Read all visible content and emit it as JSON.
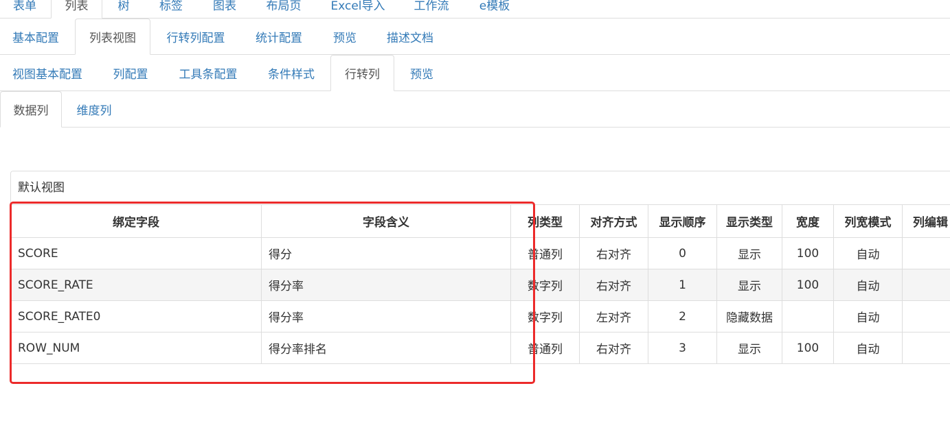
{
  "tabs_level1": [
    "表单",
    "列表",
    "树",
    "标签",
    "图表",
    "布局页",
    "Excel导入",
    "工作流",
    "e模板"
  ],
  "tabs_level2": [
    "基本配置",
    "列表视图",
    "行转列配置",
    "统计配置",
    "预览",
    "描述文档"
  ],
  "tabs_level3": [
    "视图基本配置",
    "列配置",
    "工具条配置",
    "条件样式",
    "行转列",
    "预览"
  ],
  "tabs_level4": [
    "数据列",
    "维度列"
  ],
  "panel": {
    "title": "默认视图"
  },
  "table": {
    "headers": [
      "绑定字段",
      "字段含义",
      "列类型",
      "对齐方式",
      "显示顺序",
      "显示类型",
      "宽度",
      "列宽模式",
      "列编辑"
    ],
    "rows": [
      [
        "SCORE",
        "得分",
        "普通列",
        "右对齐",
        "0",
        "显示",
        "100",
        "自动",
        ""
      ],
      [
        "SCORE_RATE",
        "得分率",
        "数字列",
        "右对齐",
        "1",
        "显示",
        "100",
        "自动",
        ""
      ],
      [
        "SCORE_RATE0",
        "得分率",
        "数字列",
        "左对齐",
        "2",
        "隐藏数据",
        "",
        "自动",
        ""
      ],
      [
        "ROW_NUM",
        "得分率排名",
        "普通列",
        "右对齐",
        "3",
        "显示",
        "100",
        "自动",
        ""
      ]
    ]
  },
  "colors": {
    "link": "#337ab7",
    "active_text": "#555555",
    "border": "#dddddd",
    "highlight": "#ec2a2a"
  }
}
